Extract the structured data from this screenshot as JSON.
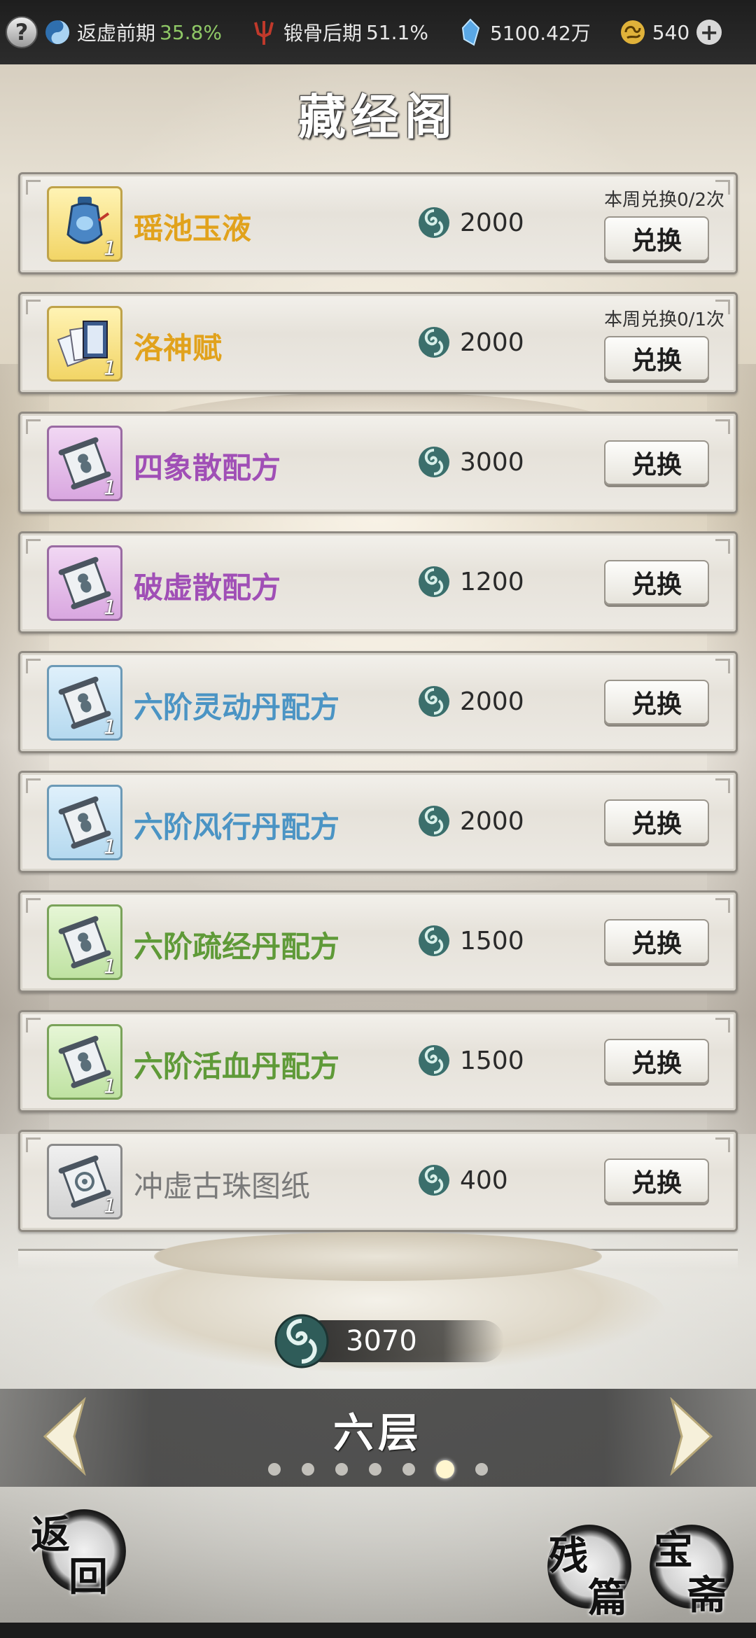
{
  "topbar": {
    "help_icon": "question-icon",
    "stats": [
      {
        "icon": "taiji-icon",
        "label": "返虚前期",
        "value": "35.8%"
      },
      {
        "icon": "trident-icon",
        "label": "锻骨后期",
        "value": "51.1%"
      },
      {
        "icon": "spirit-stone-icon",
        "label": "5100.42万",
        "value": ""
      },
      {
        "icon": "gold-ingot-icon",
        "label": "540",
        "value": ""
      }
    ],
    "plus_icon": "plus-icon"
  },
  "title": "藏经阁",
  "items": [
    {
      "name": "瑶池玉液",
      "quality": "gold",
      "count": "1",
      "price": "2000",
      "weekly": "本周兑换0/2次",
      "button": "兑换",
      "icon": "jade-vase-icon"
    },
    {
      "name": "洛神赋",
      "quality": "gold",
      "count": "1",
      "price": "2000",
      "weekly": "本周兑换0/1次",
      "button": "兑换",
      "icon": "scroll-cards-icon"
    },
    {
      "name": "四象散配方",
      "quality": "purple",
      "count": "1",
      "price": "3000",
      "weekly": "",
      "button": "兑换",
      "icon": "recipe-scroll-icon"
    },
    {
      "name": "破虚散配方",
      "quality": "purple",
      "count": "1",
      "price": "1200",
      "weekly": "",
      "button": "兑换",
      "icon": "recipe-scroll-icon"
    },
    {
      "name": "六阶灵动丹配方",
      "quality": "blue",
      "count": "1",
      "price": "2000",
      "weekly": "",
      "button": "兑换",
      "icon": "recipe-scroll-icon"
    },
    {
      "name": "六阶风行丹配方",
      "quality": "blue",
      "count": "1",
      "price": "2000",
      "weekly": "",
      "button": "兑换",
      "icon": "recipe-scroll-icon"
    },
    {
      "name": "六阶疏经丹配方",
      "quality": "green",
      "count": "1",
      "price": "1500",
      "weekly": "",
      "button": "兑换",
      "icon": "recipe-scroll-icon"
    },
    {
      "name": "六阶活血丹配方",
      "quality": "green",
      "count": "1",
      "price": "1500",
      "weekly": "",
      "button": "兑换",
      "icon": "recipe-scroll-icon"
    },
    {
      "name": "冲虚古珠图纸",
      "quality": "gray",
      "count": "1",
      "price": "400",
      "weekly": "",
      "button": "兑换",
      "icon": "blueprint-scroll-icon"
    }
  ],
  "currency": {
    "icon": "scripture-token-icon",
    "total": "3070"
  },
  "floor": {
    "name": "六层",
    "page_count": 7,
    "active_page": 6
  },
  "bottom_buttons": {
    "back": [
      "返",
      "回"
    ],
    "fragments": [
      "残",
      "篇"
    ],
    "treasure": [
      "宝",
      "斋"
    ]
  },
  "colors": {
    "gold": "#e1a21c",
    "purple": "#a04fb6",
    "blue": "#4b94c4",
    "green": "#5f9a38",
    "gray": "#7a7a7a"
  }
}
